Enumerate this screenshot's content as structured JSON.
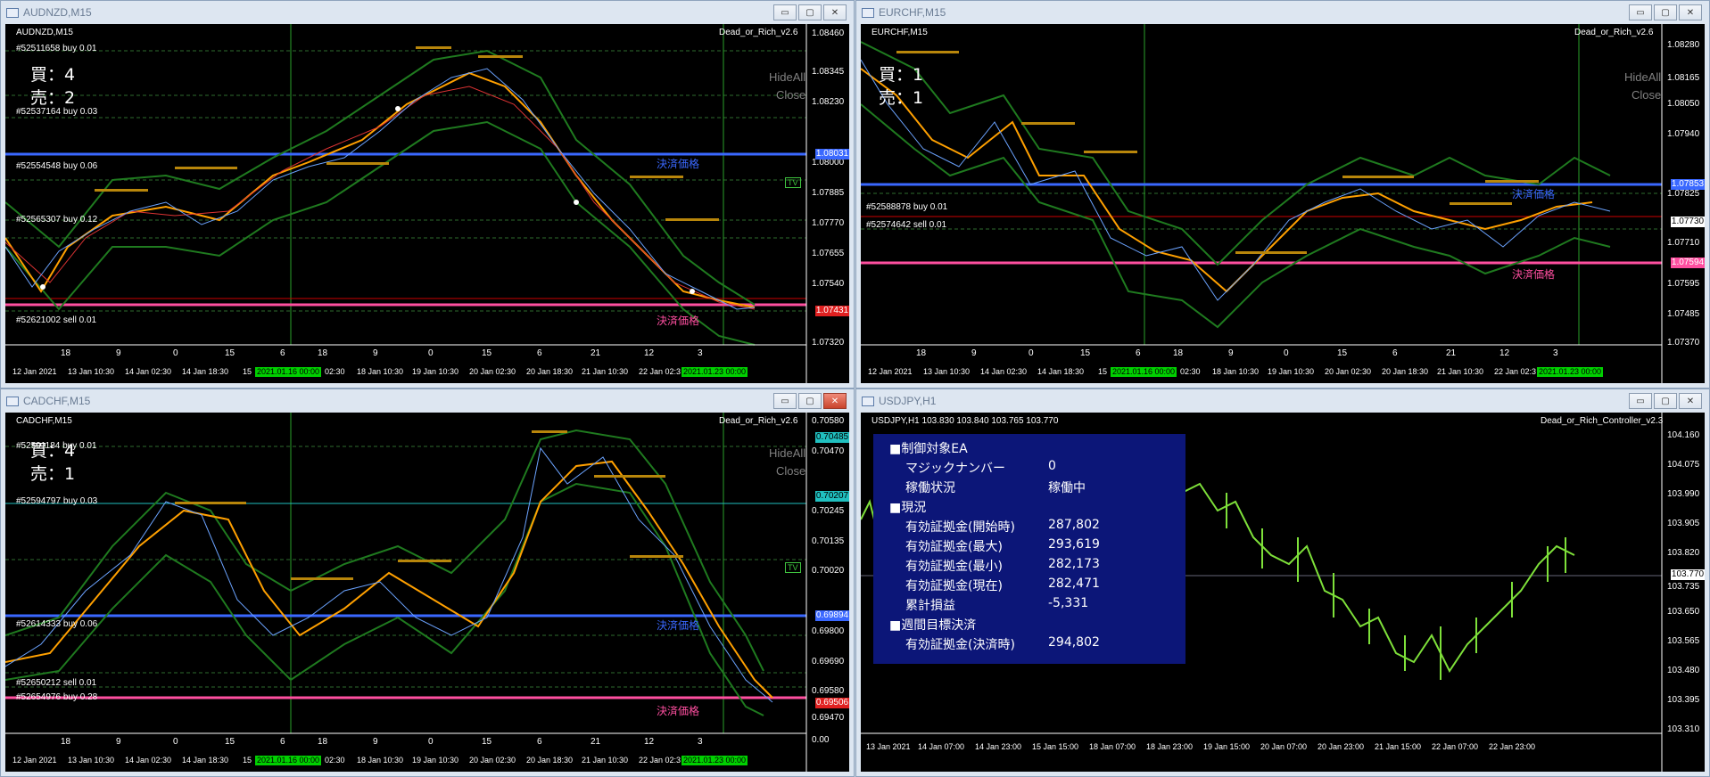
{
  "windows": [
    {
      "title": "AUDNZD,M15",
      "symbol": "AUDNZD,M15",
      "indicator": "Dead_or_Rich_v2.6",
      "buy_label": "買：4",
      "sell_label": "売：2",
      "hide_all": "HideAll",
      "close_label": "Close",
      "kessai": "決済価格",
      "order_labels": [
        "#52511658 buy 0.01",
        "#52537164 buy 0.03",
        "#52554548 buy 0.06",
        "#52565307 buy 0.12",
        "#52621002 sell 0.01"
      ],
      "price_ticks": [
        "1.08460",
        "1.08345",
        "1.08230",
        "1.08000",
        "1.07885",
        "1.07770",
        "1.07655",
        "1.07540",
        "1.07320"
      ],
      "price_boxes": [
        "1.08031",
        "1.07431"
      ],
      "time_ticks": [
        "18",
        "9",
        "0",
        "15",
        "6",
        "18",
        "9",
        "0",
        "15",
        "6",
        "21",
        "12",
        "3"
      ],
      "date_labels": [
        "12 Jan 2021",
        "13 Jan 10:30",
        "14 Jan 02:30",
        "14 Jan 18:30",
        "15",
        "02:30",
        "18 Jan 10:30",
        "19 Jan 10:30",
        "20 Jan 02:30",
        "20 Jan 18:30",
        "21 Jan 10:30",
        "22 Jan 02:3"
      ],
      "green_dates": [
        "2021.01.16 00:00",
        "2021.01.23 00:00"
      ],
      "tv": "TV"
    },
    {
      "title": "EURCHF,M15",
      "symbol": "EURCHF,M15",
      "indicator": "Dead_or_Rich_v2.6",
      "buy_label": "買：1",
      "sell_label": "売：1",
      "hide_all": "HideAll",
      "close_label": "Close",
      "kessai": "決済価格",
      "kessai2": "決済価格",
      "order_labels": [
        "#52588878 buy 0.01",
        "#52574642 sell 0.01"
      ],
      "price_ticks": [
        "1.08280",
        "1.08165",
        "1.08050",
        "1.07940",
        "1.07825",
        "1.07710",
        "1.07595",
        "1.07485",
        "1.07370"
      ],
      "price_boxes": [
        "1.07853",
        "1.07730",
        "1.07594"
      ],
      "time_ticks": [
        "18",
        "9",
        "0",
        "15",
        "6",
        "18",
        "9",
        "0",
        "15",
        "6",
        "21",
        "12",
        "3"
      ],
      "date_labels": [
        "12 Jan 2021",
        "13 Jan 10:30",
        "14 Jan 02:30",
        "14 Jan 18:30",
        "15",
        "02:30",
        "18 Jan 10:30",
        "19 Jan 10:30",
        "20 Jan 02:30",
        "20 Jan 18:30",
        "21 Jan 10:30",
        "22 Jan 02:3"
      ],
      "green_dates": [
        "2021.01.16 00:00",
        "2021.01.23 00:00"
      ]
    },
    {
      "title": "CADCHF,M15",
      "symbol": "CADCHF,M15",
      "indicator": "Dead_or_Rich_v2.6",
      "buy_label": "買：4",
      "sell_label": "売：1",
      "hide_all": "HideAll",
      "close_label": "Close",
      "kessai": "決済価格",
      "kessai2": "決済価格",
      "order_labels": [
        "#52591184 buy 0.01",
        "#52594797 buy 0.03",
        "#52614333 buy 0.06",
        "#52650212 sell 0.01",
        "#52654976 buy 0.28"
      ],
      "price_ticks": [
        "0.70580",
        "0.70470",
        "0.70245",
        "0.70135",
        "0.70020",
        "0.69800",
        "0.69690",
        "0.69580",
        "0.69470",
        "0.00"
      ],
      "price_boxes": [
        "0.70485",
        "0.70207",
        "0.69894",
        "0.69506"
      ],
      "time_ticks": [
        "18",
        "9",
        "0",
        "15",
        "6",
        "18",
        "9",
        "0",
        "15",
        "6",
        "21",
        "12",
        "3"
      ],
      "date_labels": [
        "12 Jan 2021",
        "13 Jan 10:30",
        "14 Jan 02:30",
        "14 Jan 18:30",
        "15",
        "02:30",
        "18 Jan 10:30",
        "19 Jan 10:30",
        "20 Jan 02:30",
        "20 Jan 18:30",
        "21 Jan 10:30",
        "22 Jan 02:3"
      ],
      "green_dates": [
        "2021.01.16 00:00",
        "2021.01.23 00:00"
      ],
      "tv": "TV"
    },
    {
      "title": "USDJPY,H1",
      "symbol": "USDJPY,H1 103.830 103.840 103.765 103.770",
      "indicator": "Dead_or_Rich_Controller_v2.3",
      "price_ticks": [
        "104.160",
        "104.075",
        "103.990",
        "103.905",
        "103.820",
        "103.735",
        "103.650",
        "103.565",
        "103.480",
        "103.395",
        "103.310"
      ],
      "price_box": "103.770",
      "date_labels": [
        "13 Jan 2021",
        "14 Jan 07:00",
        "14 Jan 23:00",
        "15 Jan 15:00",
        "18 Jan 07:00",
        "18 Jan 23:00",
        "19 Jan 15:00",
        "20 Jan 07:00",
        "20 Jan 23:00",
        "21 Jan 15:00",
        "22 Jan 07:00",
        "22 Jan 23:00"
      ]
    }
  ],
  "panel": {
    "rows": [
      {
        "label": "■制御対象EA",
        "value": ""
      },
      {
        "label": "マジックナンバー",
        "value": "0"
      },
      {
        "label": "稼働状況",
        "value": "稼働中"
      },
      {
        "label": "■現況",
        "value": ""
      },
      {
        "label": "有効証拠金(開始時)",
        "value": "287,802"
      },
      {
        "label": "有効証拠金(最大)",
        "value": "293,619"
      },
      {
        "label": "有効証拠金(最小)",
        "value": "282,173"
      },
      {
        "label": "有効証拠金(現在)",
        "value": "282,471"
      },
      {
        "label": "累計損益",
        "value": "-5,331"
      },
      {
        "label": "■週間目標決済",
        "value": ""
      },
      {
        "label": "有効証拠金(決済時)",
        "value": "294,802"
      }
    ]
  },
  "colors": {
    "kessai_blue": "#3a68ff",
    "kessai_pink": "#ff4fa0",
    "band_green": "#1f7a1f",
    "ma_orange": "#ffa000",
    "panel_bg": "#0c1678",
    "date_green": "#00d000"
  }
}
